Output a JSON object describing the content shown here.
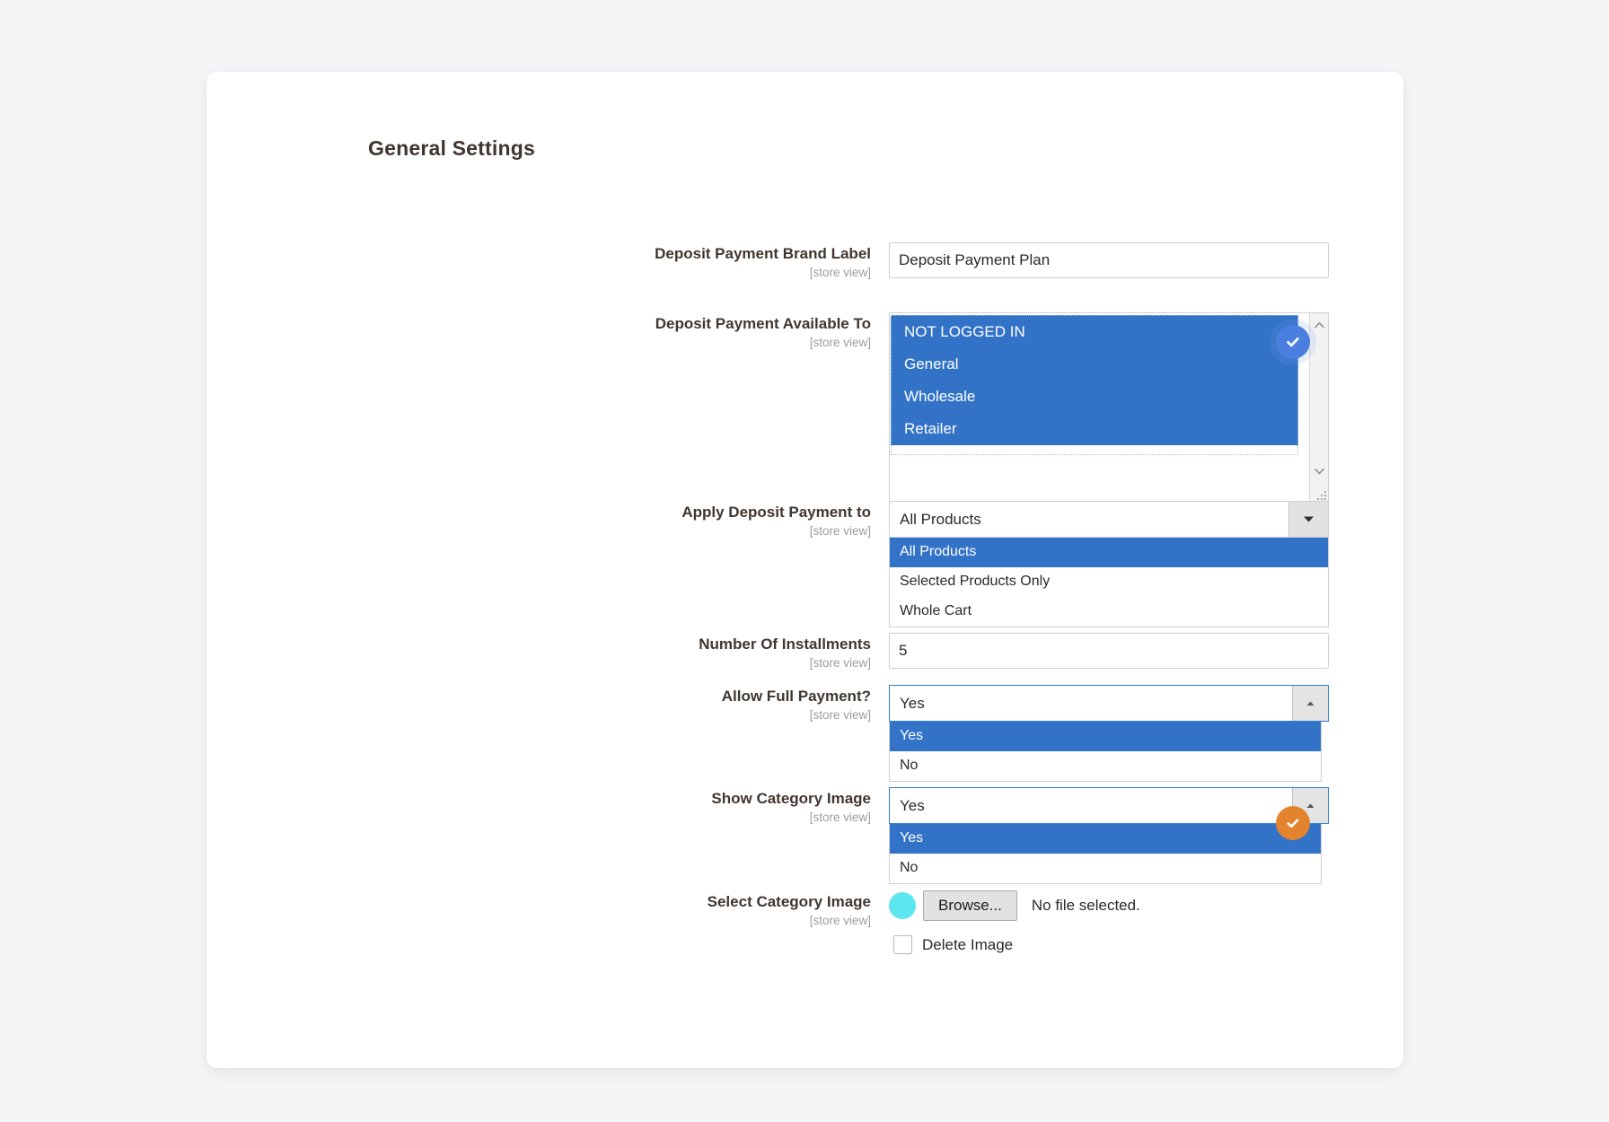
{
  "section": {
    "title": "General Settings"
  },
  "fields": {
    "brand_label": {
      "label": "Deposit Payment Brand Label",
      "scope": "[store view]",
      "value": "Deposit Payment Plan"
    },
    "available_to": {
      "label": "Deposit Payment Available To",
      "scope": "[store view]",
      "options": [
        "NOT LOGGED IN",
        "General",
        "Wholesale",
        "Retailer"
      ],
      "selected": [
        "NOT LOGGED IN",
        "General",
        "Wholesale",
        "Retailer"
      ],
      "scroll_up_icon": "chevron-up-icon",
      "scroll_down_icon": "chevron-down-icon",
      "resize_icon": "resize-grip-icon"
    },
    "apply_to": {
      "label": "Apply Deposit Payment to",
      "scope": "[store view]",
      "value": "All Products",
      "arrow_icon": "chevron-down-icon",
      "options": [
        "All Products",
        "Selected Products Only",
        "Whole Cart"
      ],
      "selected": "All Products"
    },
    "installments": {
      "label": "Number Of Installments",
      "scope": "[store view]",
      "value": "5"
    },
    "allow_full_payment": {
      "label": "Allow Full Payment?",
      "scope": "[store view]",
      "value": "Yes",
      "arrow_icon": "chevron-up-icon",
      "options": [
        "Yes",
        "No"
      ],
      "selected": "Yes"
    },
    "show_category_image": {
      "label": "Show Category Image",
      "scope": "[store view]",
      "value": "Yes",
      "arrow_icon": "chevron-up-icon",
      "options": [
        "Yes",
        "No"
      ],
      "selected": "Yes"
    },
    "select_category_image": {
      "label": "Select Category Image",
      "scope": "[store view]",
      "browse_label": "Browse...",
      "file_status": "No file selected.",
      "delete_label": "Delete Image",
      "delete_checked": false,
      "marker_icon": "cyan-dot-marker"
    }
  },
  "badges": {
    "available_to": {
      "icon": "check-circle-icon",
      "color": "#4a7fe0"
    },
    "show_category_image": {
      "icon": "check-circle-icon",
      "color": "#e4832e"
    }
  }
}
